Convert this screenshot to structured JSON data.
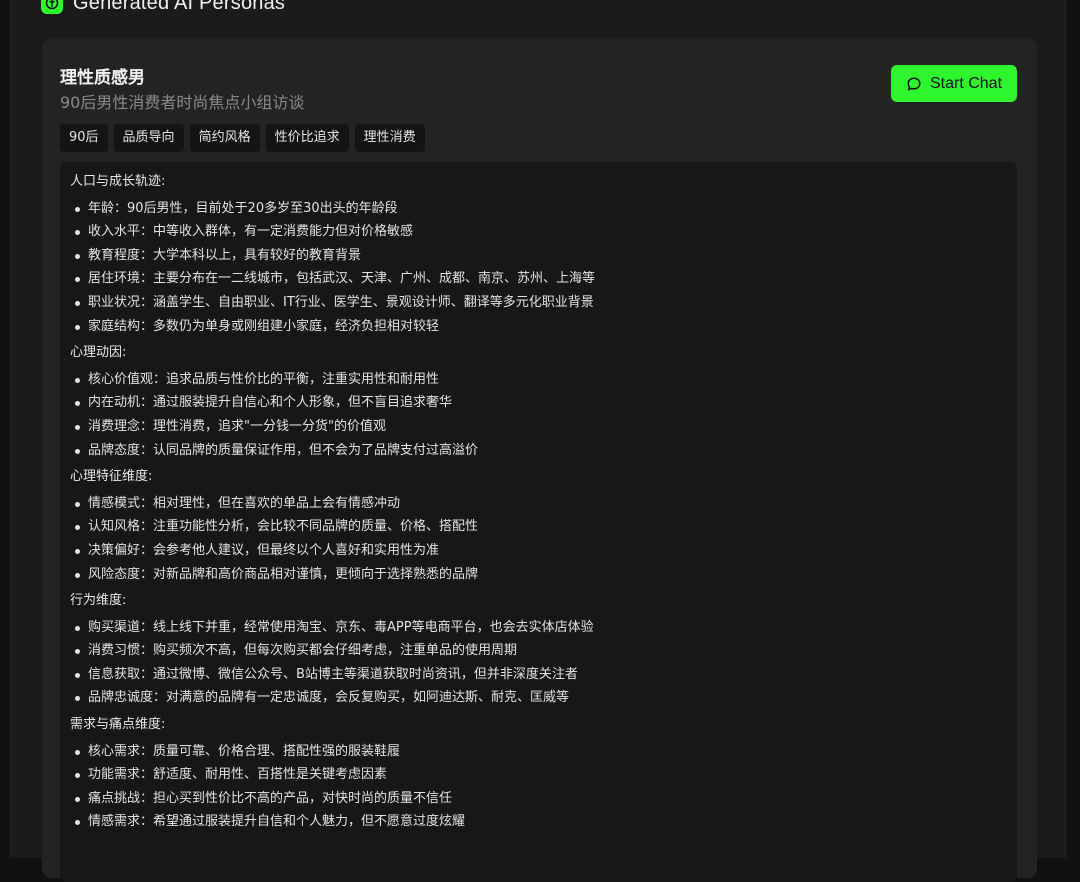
{
  "header": {
    "title": "Generated AI Personas"
  },
  "persona": {
    "name": "理性质感男",
    "subtitle": "90后男性消费者时尚焦点小组访谈",
    "start_chat_label": "Start Chat",
    "tags": [
      "90后",
      "品质导向",
      "简约风格",
      "性价比追求",
      "理性消费"
    ]
  },
  "sections": [
    {
      "title": "人口与成长轨迹:",
      "items": [
        "年龄：90后男性，目前处于20多岁至30出头的年龄段",
        "收入水平：中等收入群体，有一定消费能力但对价格敏感",
        "教育程度：大学本科以上，具有较好的教育背景",
        "居住环境：主要分布在一二线城市，包括武汉、天津、广州、成都、南京、苏州、上海等",
        "职业状况：涵盖学生、自由职业、IT行业、医学生、景观设计师、翻译等多元化职业背景",
        "家庭结构：多数仍为单身或刚组建小家庭，经济负担相对较轻"
      ]
    },
    {
      "title": "心理动因:",
      "items": [
        "核心价值观：追求品质与性价比的平衡，注重实用性和耐用性",
        "内在动机：通过服装提升自信心和个人形象，但不盲目追求奢华",
        "消费理念：理性消费，追求\"一分钱一分货\"的价值观",
        "品牌态度：认同品牌的质量保证作用，但不会为了品牌支付过高溢价"
      ]
    },
    {
      "title": "心理特征维度:",
      "items": [
        "情感模式：相对理性，但在喜欢的单品上会有情感冲动",
        "认知风格：注重功能性分析，会比较不同品牌的质量、价格、搭配性",
        "决策偏好：会参考他人建议，但最终以个人喜好和实用性为准",
        "风险态度：对新品牌和高价商品相对谨慎，更倾向于选择熟悉的品牌"
      ]
    },
    {
      "title": "行为维度:",
      "items": [
        "购买渠道：线上线下并重，经常使用淘宝、京东、毒APP等电商平台，也会去实体店体验",
        "消费习惯：购买频次不高，但每次购买都会仔细考虑，注重单品的使用周期",
        "信息获取：通过微博、微信公众号、B站博主等渠道获取时尚资讯，但并非深度关注者",
        "品牌忠诚度：对满意的品牌有一定忠诚度，会反复购买，如阿迪达斯、耐克、匡威等"
      ]
    },
    {
      "title": "需求与痛点维度:",
      "items": [
        "核心需求：质量可靠、价格合理、搭配性强的服装鞋履",
        "功能需求：舒适度、耐用性、百搭性是关键考虑因素",
        "痛点挑战：担心买到性价比不高的产品，对快时尚的质量不信任",
        "情感需求：希望通过服装提升自信和个人魅力，但不愿意过度炫耀"
      ]
    }
  ]
}
